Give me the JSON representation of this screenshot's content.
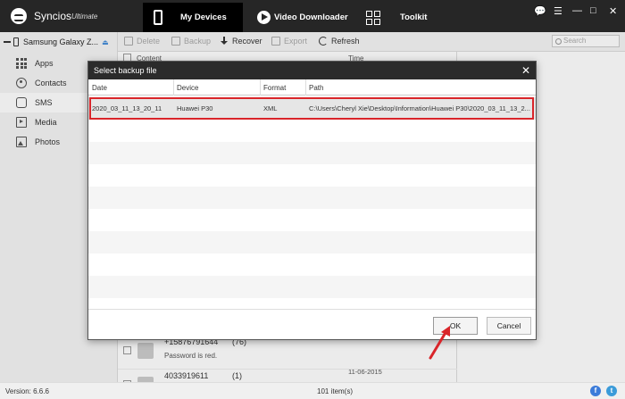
{
  "app": {
    "name": "Syncios",
    "edition": "Ultimate"
  },
  "nav": {
    "tabs": [
      "My Devices",
      "Video Downloader",
      "Toolkit"
    ]
  },
  "window_controls": [
    "💬",
    "☰",
    "—",
    "□",
    "✕"
  ],
  "device": {
    "name": "Samsung Galaxy Z..."
  },
  "sidebar": {
    "items": [
      "Apps",
      "Contacts",
      "SMS",
      "Media",
      "Photos"
    ],
    "active": "SMS"
  },
  "toolbar": {
    "delete": "Delete",
    "backup": "Backup",
    "recover": "Recover",
    "export": "Export",
    "refresh": "Refresh",
    "search_placeholder": "Search"
  },
  "content": {
    "headers": {
      "content": "Content",
      "time": "Time"
    },
    "messages": [
      {
        "number": "+15876791644",
        "count": "(76)",
        "text": "Password is red.",
        "date": "11-06-2015"
      },
      {
        "number": "4033919611",
        "count": "(1)",
        "text": "",
        "date": "11-06-2015"
      }
    ]
  },
  "dialog": {
    "title": "Select backup file",
    "close": "✕",
    "columns": {
      "date": "Date",
      "device": "Device",
      "format": "Format",
      "path": "Path"
    },
    "rows": [
      {
        "date": "2020_03_11_13_20_11",
        "device": "Huawei P30",
        "format": "XML",
        "path": "C:\\Users\\Cheryl Xie\\Desktop\\Information\\Huawei P30\\2020_03_11_13_2..."
      }
    ],
    "ok": "OK",
    "cancel": "Cancel"
  },
  "status": {
    "version": "Version: 6.6.6",
    "count": "101 item(s)"
  },
  "social": {
    "facebook": "f",
    "twitter": "t"
  },
  "colors": {
    "highlight": "#d9252a",
    "titlebar": "#262626",
    "accent": "#3b9bd9"
  }
}
